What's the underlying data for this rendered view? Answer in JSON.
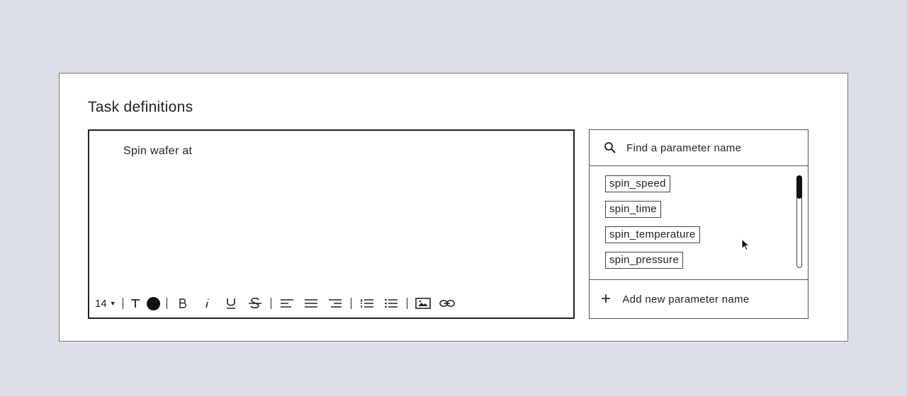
{
  "card": {
    "title": "Task definitions"
  },
  "editor": {
    "content": "Spin wafer at",
    "toolbar": {
      "font_size": "14",
      "text_icon": "T",
      "bold": "B",
      "italic": "i",
      "underline": "U",
      "strike": "S",
      "color": "#111111"
    }
  },
  "panel": {
    "search": {
      "placeholder": "Find a parameter name",
      "icon": "search-icon"
    },
    "parameters": [
      "spin_speed",
      "spin_time",
      "spin_temperature",
      "spin_pressure"
    ],
    "add_label": "Add new parameter name"
  },
  "colors": {
    "background": "#dcdfe7",
    "card": "#ffffff",
    "ink": "#222222"
  }
}
